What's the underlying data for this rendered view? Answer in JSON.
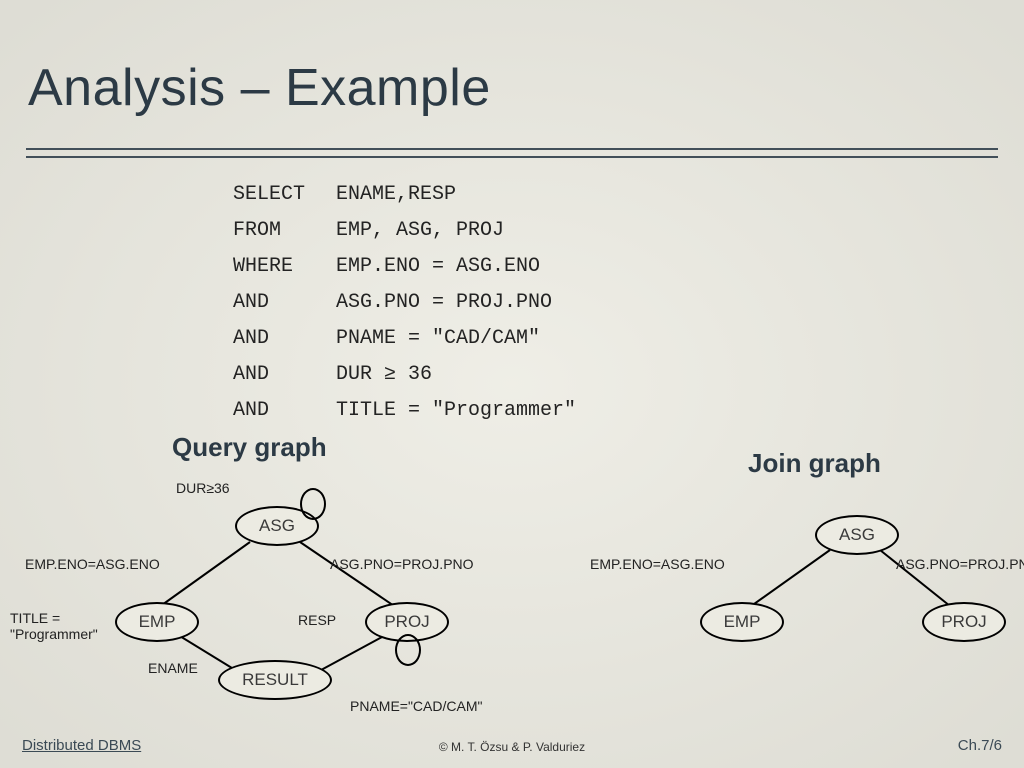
{
  "title": "Analysis – Example",
  "sql": {
    "rows": [
      {
        "kw": "SELECT",
        "val": "ENAME,RESP"
      },
      {
        "kw": "FROM",
        "val": "EMP, ASG, PROJ"
      },
      {
        "kw": "WHERE",
        "val": "EMP.ENO = ASG.ENO"
      },
      {
        "kw": "AND",
        "val": "ASG.PNO = PROJ.PNO"
      },
      {
        "kw": "AND",
        "val": "PNAME = \"CAD/CAM\""
      },
      {
        "kw": "AND",
        "val": "DUR ≥ 36"
      },
      {
        "kw": "AND",
        "val": "TITLE = \"Programmer\""
      }
    ]
  },
  "headings": {
    "query_graph": "Query graph",
    "join_graph": "Join graph"
  },
  "query_graph": {
    "nodes": {
      "asg": "ASG",
      "emp": "EMP",
      "proj": "PROJ",
      "result": "RESULT"
    },
    "labels": {
      "dur": "DUR≥36",
      "eno": "EMP.ENO=ASG.ENO",
      "pno": "ASG.PNO=PROJ.PNO",
      "title": "TITLE = \"Programmer\"",
      "ename": "ENAME",
      "resp": "RESP",
      "pname": "PNAME=\"CAD/CAM\""
    }
  },
  "join_graph": {
    "nodes": {
      "asg": "ASG",
      "emp": "EMP",
      "proj": "PROJ"
    },
    "labels": {
      "eno": "EMP.ENO=ASG.ENO",
      "pno": "ASG.PNO=PROJ.PNO"
    }
  },
  "footer": {
    "left": "Distributed DBMS",
    "center": "© M. T. Özsu & P. Valduriez",
    "right": "Ch.7/6"
  }
}
